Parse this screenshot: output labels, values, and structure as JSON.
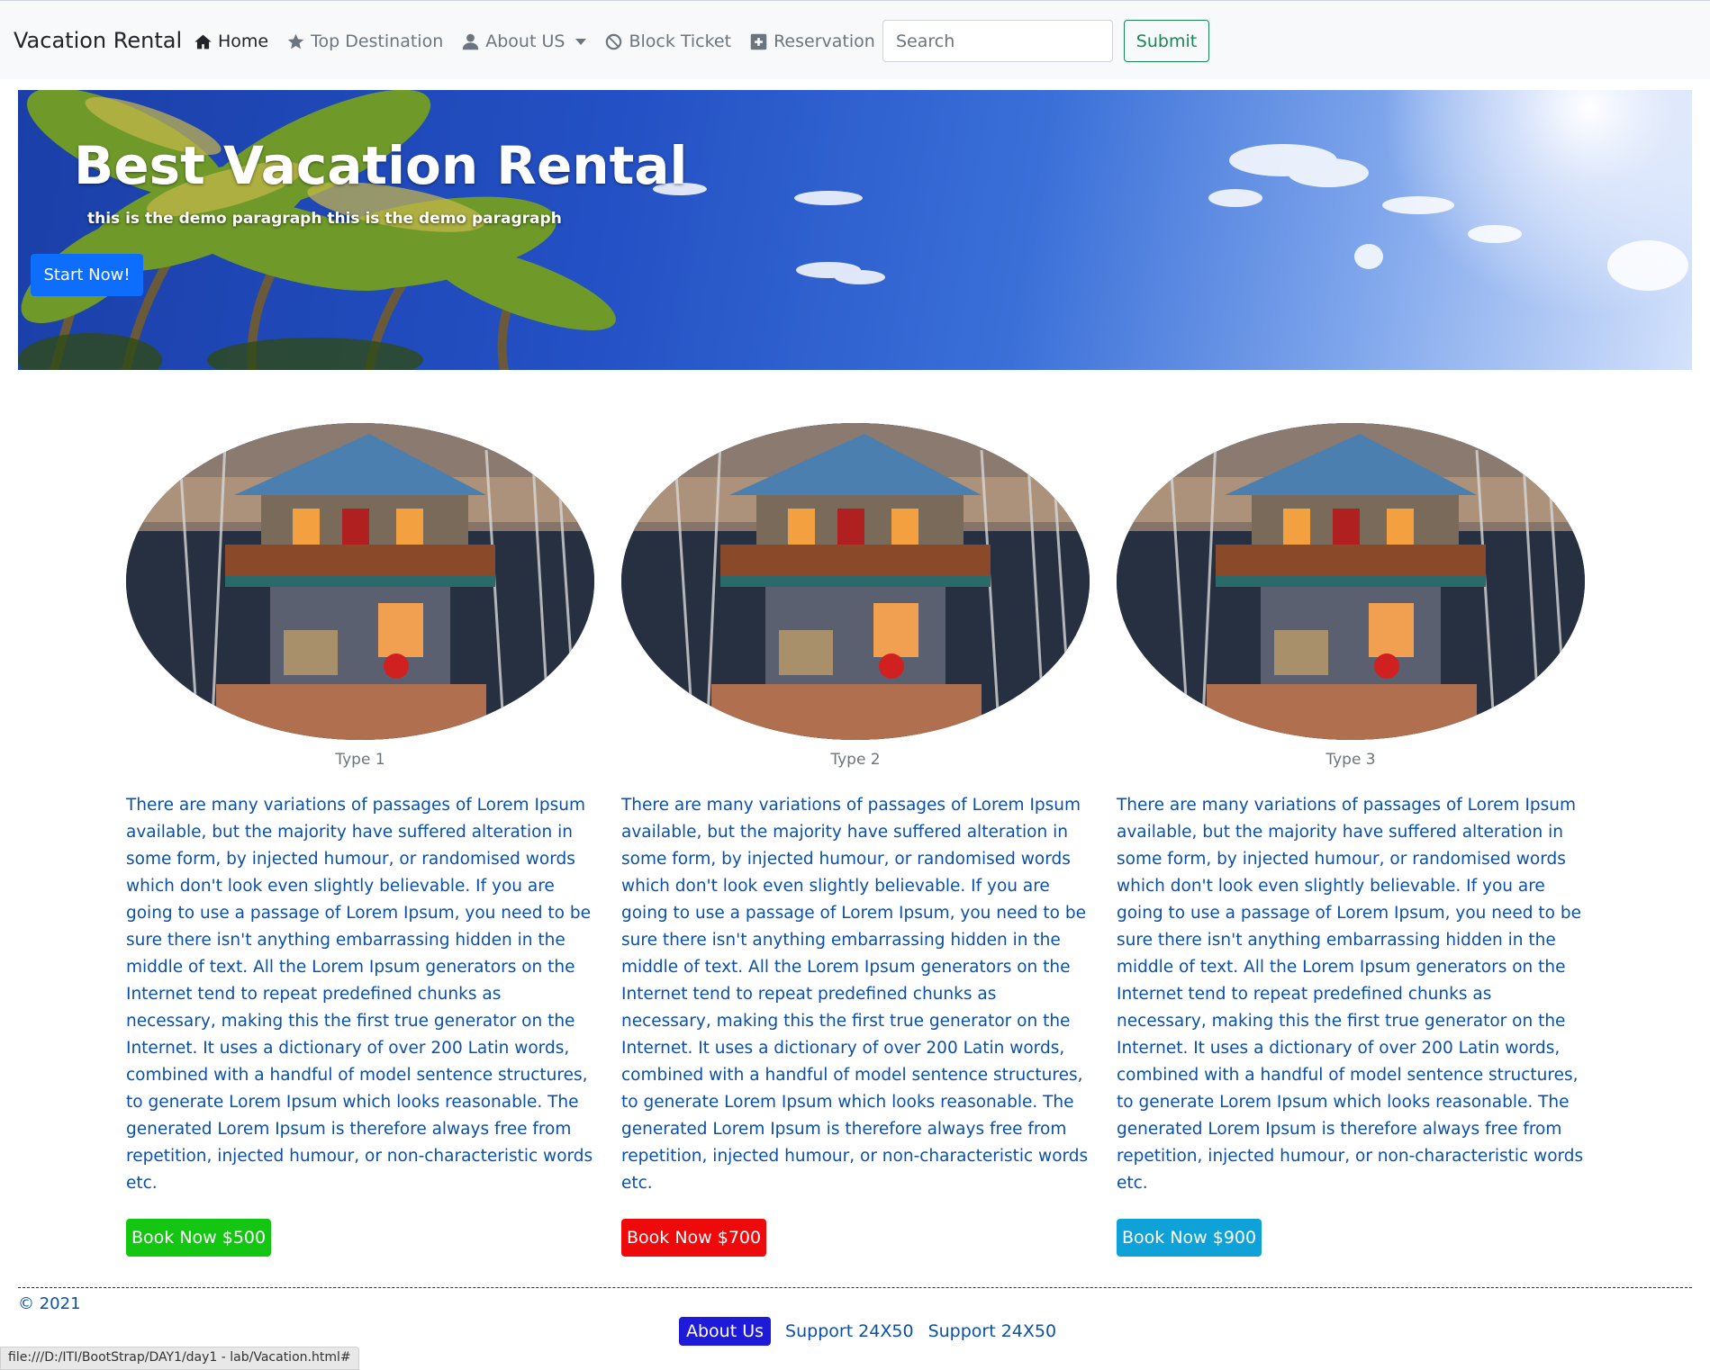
{
  "navbar": {
    "brand": "Vacation Rental",
    "links": [
      {
        "label": "Home",
        "icon": "home-icon",
        "active": true
      },
      {
        "label": "Top Destination",
        "icon": "star-icon"
      },
      {
        "label": "About US",
        "icon": "user-icon",
        "dropdown": true
      },
      {
        "label": "Block Ticket",
        "icon": "ban-icon"
      },
      {
        "label": "Reservation",
        "icon": "plus-square-icon"
      }
    ],
    "search_placeholder": "Search",
    "submit_label": "Submit"
  },
  "hero": {
    "title": "Best Vacation Rental",
    "subtitle": "this is the demo paragraph this is the demo paragraph",
    "button_label": "Start Now!"
  },
  "cards": [
    {
      "caption": "Type 1",
      "text": "There are many variations of passages of Lorem Ipsum available, but the majority have suffered alteration in some form, by injected humour, or randomised words which don't look even slightly believable. If you are going to use a passage of Lorem Ipsum, you need to be sure there isn't anything embarrassing hidden in the middle of text. All the Lorem Ipsum generators on the Internet tend to repeat predefined chunks as necessary, making this the first true generator on the Internet. It uses a dictionary of over 200 Latin words, combined with a handful of model sentence structures, to generate Lorem Ipsum which looks reasonable. The generated Lorem Ipsum is therefore always free from repetition, injected humour, or non-characteristic words etc.",
      "button_label": "Book Now $500",
      "button_color": "#12c612"
    },
    {
      "caption": "Type 2",
      "text": "There are many variations of passages of Lorem Ipsum available, but the majority have suffered alteration in some form, by injected humour, or randomised words which don't look even slightly believable. If you are going to use a passage of Lorem Ipsum, you need to be sure there isn't anything embarrassing hidden in the middle of text. All the Lorem Ipsum generators on the Internet tend to repeat predefined chunks as necessary, making this the first true generator on the Internet. It uses a dictionary of over 200 Latin words, combined with a handful of model sentence structures, to generate Lorem Ipsum which looks reasonable. The generated Lorem Ipsum is therefore always free from repetition, injected humour, or non-characteristic words etc.",
      "button_label": "Book Now $700",
      "button_color": "#ee0a0a"
    },
    {
      "caption": "Type 3",
      "text": "There are many variations of passages of Lorem Ipsum available, but the majority have suffered alteration in some form, by injected humour, or randomised words which don't look even slightly believable. If you are going to use a passage of Lorem Ipsum, you need to be sure there isn't anything embarrassing hidden in the middle of text. All the Lorem Ipsum generators on the Internet tend to repeat predefined chunks as necessary, making this the first true generator on the Internet. It uses a dictionary of over 200 Latin words, combined with a handful of model sentence structures, to generate Lorem Ipsum which looks reasonable. The generated Lorem Ipsum is therefore always free from repetition, injected humour, or non-characteristic words etc.",
      "button_label": "Book Now $900",
      "button_color": "#0fa2d8"
    }
  ],
  "footer": {
    "copyright": "© 2021",
    "about_label": "About Us",
    "support_links": [
      "Support 24X50",
      "Support 24X50"
    ]
  },
  "status_bar": "file:///D:/ITI/BootStrap/DAY1/day1 - lab/Vacation.html#"
}
